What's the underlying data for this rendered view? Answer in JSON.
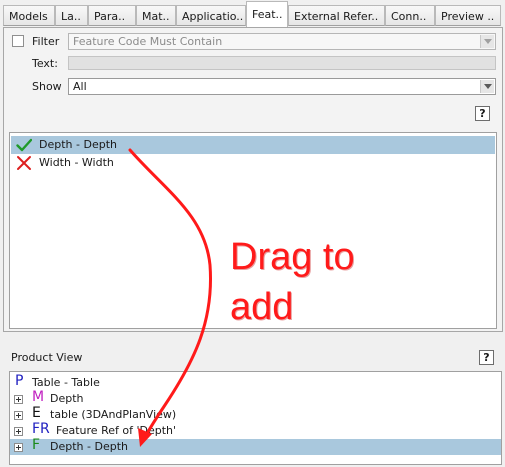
{
  "tabs": [
    {
      "label": "Models"
    },
    {
      "label": "La.."
    },
    {
      "label": "Para.."
    },
    {
      "label": "Mat.."
    },
    {
      "label": "Applicatio.."
    },
    {
      "label": "Feat.."
    },
    {
      "label": "External Refer.."
    },
    {
      "label": "Conn.."
    },
    {
      "label": "Preview .."
    }
  ],
  "filter": {
    "checkbox_label": "Filter",
    "code_placeholder": "Feature Code Must Contain",
    "text_label": "Text:",
    "text_value": "",
    "show_label": "Show",
    "show_value": "All",
    "help_label": "?"
  },
  "features": [
    {
      "label": "Depth - Depth",
      "icon": "check-icon",
      "selected": true
    },
    {
      "label": "Width - Width",
      "icon": "cross-icon",
      "selected": false
    }
  ],
  "annotation": {
    "line1": "Drag to",
    "line2": "add",
    "color": "#ff1a1a"
  },
  "product_view": {
    "title": "Product View",
    "help_label": "?",
    "items": [
      {
        "letter": "P",
        "letter_color": "#2020c0",
        "label": "Table - Table"
      },
      {
        "letter": "M",
        "letter_color": "#c020c0",
        "label": "Depth"
      },
      {
        "letter": "E",
        "letter_color": "#111111",
        "label": "table (3DAndPlanView)"
      },
      {
        "letter": "FR",
        "letter_color": "#2020c0",
        "label": "Feature Ref of 'Depth'"
      },
      {
        "letter": "F",
        "letter_color": "#1a8a1a",
        "label": "Depth - Depth"
      }
    ]
  },
  "colors": {
    "selection": "#a9c8dd",
    "background": "#f0f0f0"
  }
}
